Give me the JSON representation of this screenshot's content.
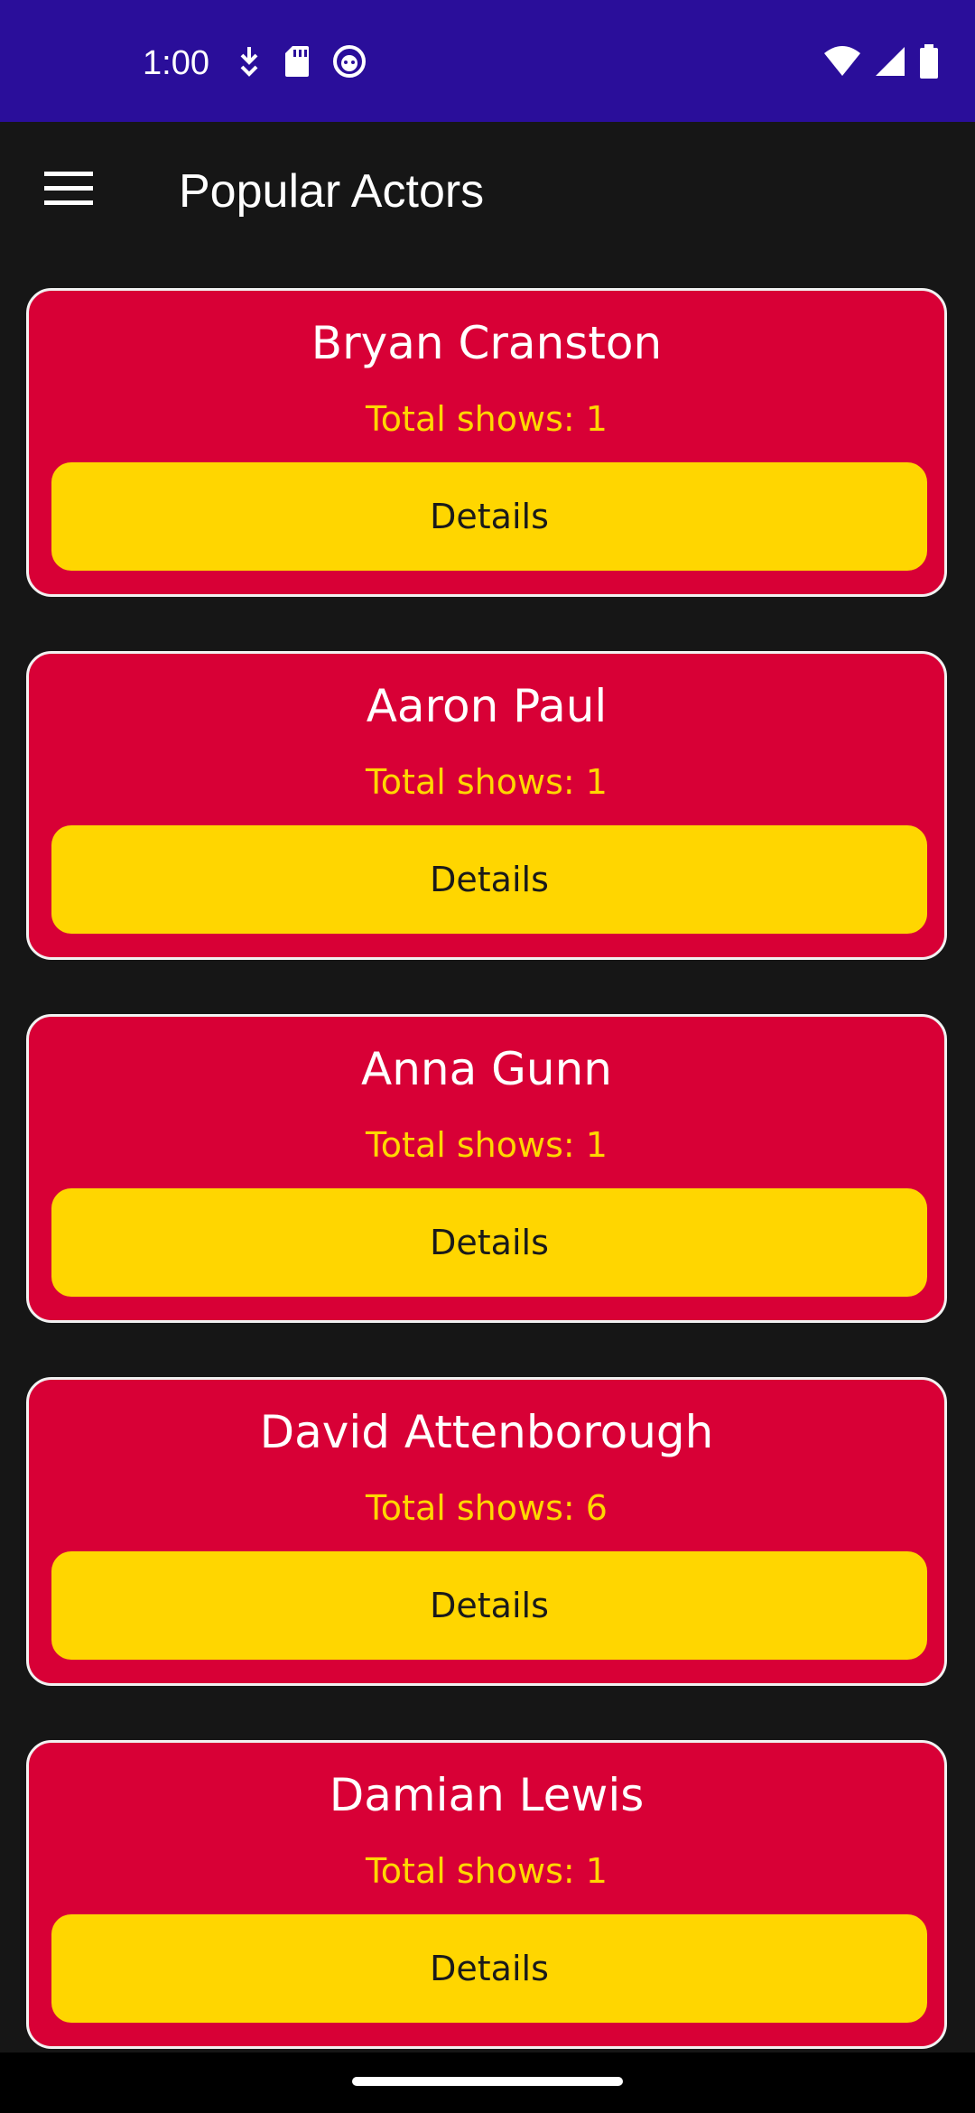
{
  "status_bar": {
    "time": "1:00",
    "left_icons": [
      "download-icon",
      "sd-card-icon",
      "face-icon"
    ],
    "right_icons": [
      "wifi-icon",
      "cell-signal-icon",
      "battery-icon"
    ]
  },
  "app_bar": {
    "title": "Popular Actors",
    "menu_icon": "hamburger-menu-icon"
  },
  "actors": [
    {
      "name": "Bryan Cranston",
      "total_shows": "Total shows: 1",
      "button": "Details"
    },
    {
      "name": "Aaron Paul",
      "total_shows": "Total shows: 1",
      "button": "Details"
    },
    {
      "name": "Anna Gunn",
      "total_shows": "Total shows: 1",
      "button": "Details"
    },
    {
      "name": "David Attenborough",
      "total_shows": "Total shows: 6",
      "button": "Details"
    },
    {
      "name": "Damian Lewis",
      "total_shows": "Total shows: 1",
      "button": "Details"
    }
  ],
  "colors": {
    "status_bar": "#2a0e9a",
    "background": "#161616",
    "card": "#d80036",
    "card_border": "#f1f1f1",
    "subtitle": "#ffd700",
    "button": "#ffd600"
  }
}
